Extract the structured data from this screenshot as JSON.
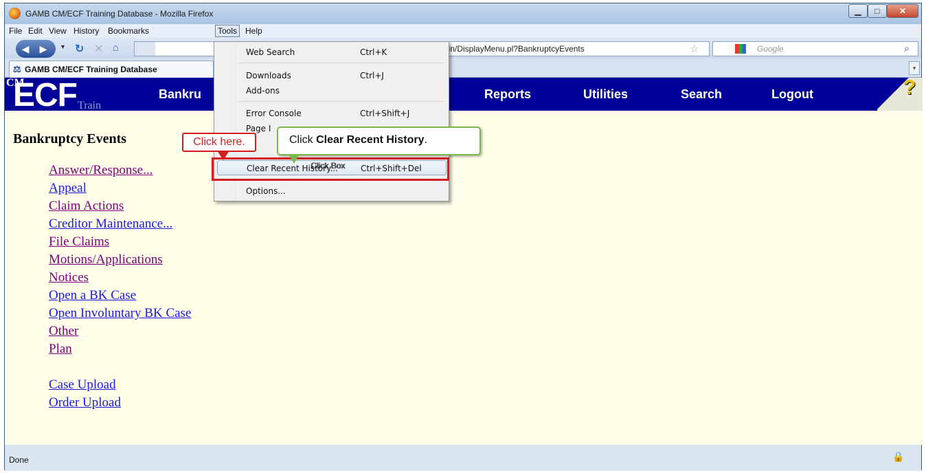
{
  "window": {
    "title": "GAMB CM/ECF Training Database - Mozilla Firefox"
  },
  "menubar": [
    "File",
    "Edit",
    "View",
    "History",
    "Bookmarks",
    "Tools",
    "Help"
  ],
  "navbar": {
    "url_text": "-bin/DisplayMenu.pl?BankruptcyEvents",
    "search_placeholder": "Google"
  },
  "tab": {
    "title": "GAMB CM/ECF Training Database"
  },
  "ecf": {
    "logo_cm": "CM",
    "logo_ecf": "ECF",
    "logo_train": "Train",
    "nav": [
      "Bankru",
      "Reports",
      "Utilities",
      "Search",
      "Logout"
    ],
    "help_glyph": "?"
  },
  "page": {
    "title": "Bankruptcy Events",
    "links": [
      {
        "label": "Answer/Response...",
        "visited": true
      },
      {
        "label": "Appeal",
        "visited": false
      },
      {
        "label": "Claim Actions",
        "visited": true
      },
      {
        "label": "Creditor Maintenance...",
        "visited": false
      },
      {
        "label": "File Claims",
        "visited": true
      },
      {
        "label": "Motions/Applications",
        "visited": true
      },
      {
        "label": "Notices",
        "visited": true
      },
      {
        "label": "Open a BK Case",
        "visited": false
      },
      {
        "label": "Open Involuntary BK Case",
        "visited": false
      },
      {
        "label": "Other",
        "visited": true
      },
      {
        "label": "Plan",
        "visited": true
      },
      {
        "label": "Case Upload",
        "visited": false
      },
      {
        "label": "Order Upload",
        "visited": false
      }
    ]
  },
  "tools_menu": {
    "items": [
      {
        "label": "Web Search",
        "shortcut": "Ctrl+K"
      },
      {
        "label": "Downloads",
        "shortcut": "Ctrl+J"
      },
      {
        "label": "Add-ons",
        "shortcut": ""
      },
      {
        "label": "Error Console",
        "shortcut": "Ctrl+Shift+J"
      },
      {
        "label": "Page I",
        "shortcut": ""
      },
      {
        "label": "Clear Recent History...",
        "shortcut": "Ctrl+Shift+Del"
      },
      {
        "label": "Options...",
        "shortcut": ""
      }
    ],
    "highlighted_index": 5
  },
  "callouts": {
    "red": "Click here.",
    "green_prefix": "Click ",
    "green_bold": "Clear Recent History",
    "green_suffix": ".",
    "box_label": "Click Box"
  },
  "statusbar": {
    "text": "Done"
  }
}
